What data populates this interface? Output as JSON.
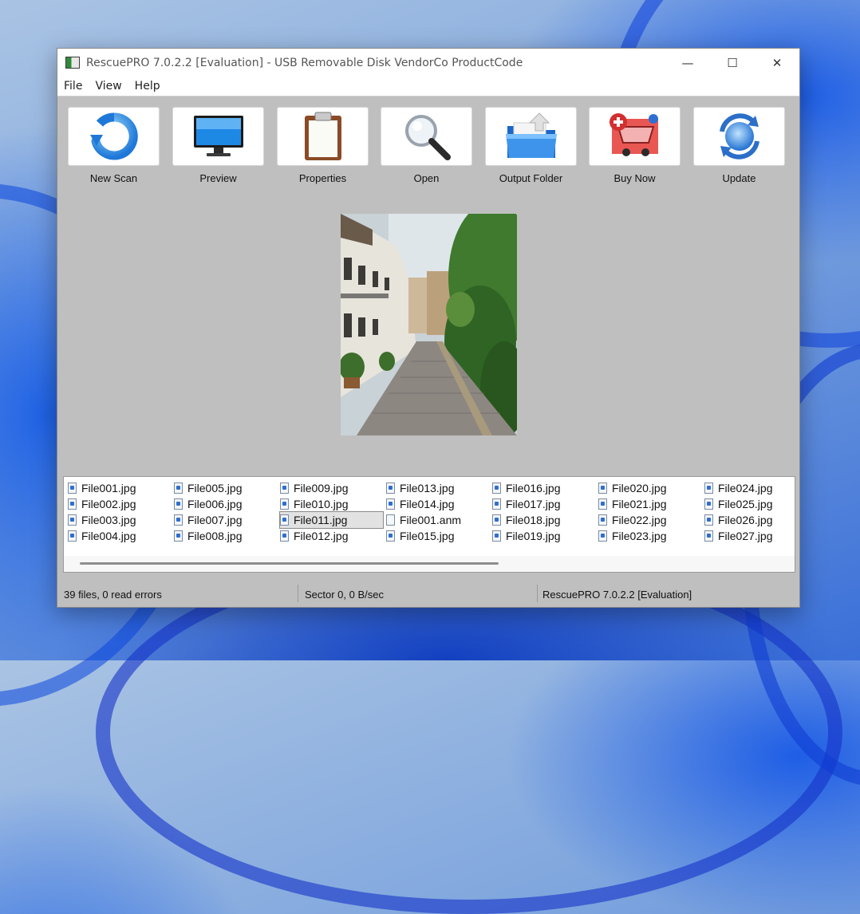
{
  "window": {
    "title": "RescuePRO 7.0.2.2 [Evaluation] - USB Removable Disk VendorCo ProductCode",
    "controls": {
      "minimize": "—",
      "maximize": "☐",
      "close": "✕"
    }
  },
  "menu": [
    "File",
    "View",
    "Help"
  ],
  "toolbar": [
    {
      "label": "New Scan",
      "icon": "new-scan-icon"
    },
    {
      "label": "Preview",
      "icon": "monitor-icon"
    },
    {
      "label": "Properties",
      "icon": "clipboard-icon"
    },
    {
      "label": "Open",
      "icon": "magnifier-icon"
    },
    {
      "label": "Output Folder",
      "icon": "folder-icon"
    },
    {
      "label": "Buy Now",
      "icon": "cart-icon"
    },
    {
      "label": "Update",
      "icon": "update-icon"
    }
  ],
  "preview": {
    "content": "street photo of a cobblestone lane with townhouses and trees"
  },
  "files": {
    "columns": [
      [
        "File001.jpg",
        "File002.jpg",
        "File003.jpg",
        "File004.jpg"
      ],
      [
        "File005.jpg",
        "File006.jpg",
        "File007.jpg",
        "File008.jpg"
      ],
      [
        "File009.jpg",
        "File010.jpg",
        "File011.jpg",
        "File012.jpg"
      ],
      [
        "File013.jpg",
        "File014.jpg",
        "File001.anm",
        "File015.jpg"
      ],
      [
        "File016.jpg",
        "File017.jpg",
        "File018.jpg",
        "File019.jpg"
      ],
      [
        "File020.jpg",
        "File021.jpg",
        "File022.jpg",
        "File023.jpg"
      ],
      [
        "File024.jpg",
        "File025.jpg",
        "File026.jpg",
        "File027.jpg"
      ]
    ],
    "selected": "File011.jpg"
  },
  "status": {
    "files": "39 files, 0 read errors",
    "sector": "Sector 0, 0 B/sec",
    "version": "RescuePRO 7.0.2.2 [Evaluation]"
  }
}
